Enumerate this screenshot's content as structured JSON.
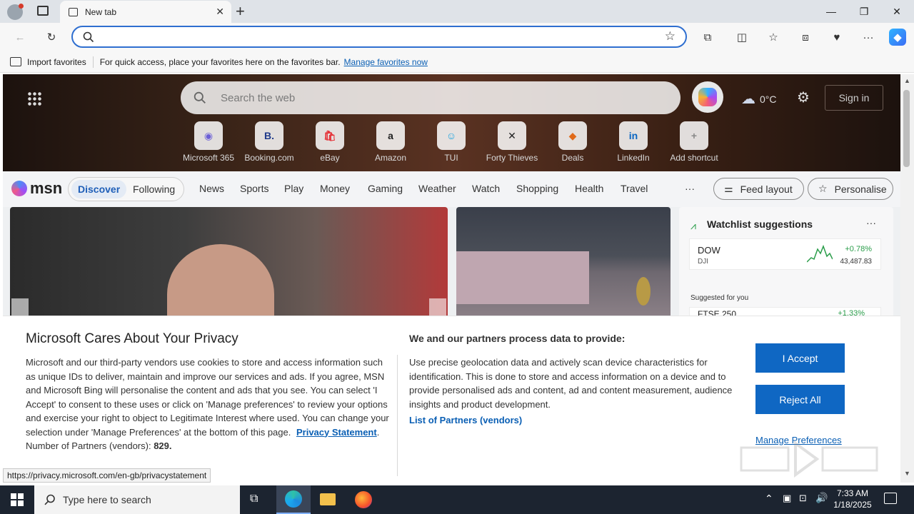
{
  "browser": {
    "tab_title": "New tab",
    "address_value": "",
    "fav_import": "Import favorites",
    "fav_hint": "For quick access, place your favorites here on the favorites bar.",
    "fav_manage": "Manage favorites now"
  },
  "msn": {
    "search_placeholder": "Search the web",
    "temperature": "0°C",
    "sign_in": "Sign in",
    "shortcuts": [
      {
        "label": "Microsoft 365",
        "glyph": "◉"
      },
      {
        "label": "Booking.com",
        "glyph": "B."
      },
      {
        "label": "eBay",
        "glyph": "🛍"
      },
      {
        "label": "Amazon",
        "glyph": "a"
      },
      {
        "label": "TUI",
        "glyph": "☺"
      },
      {
        "label": "Forty Thieves",
        "glyph": "✕"
      },
      {
        "label": "Deals",
        "glyph": "◆"
      },
      {
        "label": "LinkedIn",
        "glyph": "in"
      },
      {
        "label": "Add shortcut",
        "glyph": "+"
      }
    ],
    "logo": "msn",
    "nav": {
      "discover": "Discover",
      "following": "Following",
      "items": [
        "News",
        "Sports",
        "Play",
        "Money",
        "Gaming",
        "Weather",
        "Watch",
        "Shopping",
        "Health",
        "Travel"
      ],
      "more": "···",
      "feed_layout": "Feed layout",
      "personalise": "Personalise"
    },
    "watchlist": {
      "title": "Watchlist suggestions",
      "dow_name": "DOW",
      "dow_sub": "DJI",
      "dow_change": "+0.78%",
      "dow_value": "43,487.83",
      "suggested": "Suggested for you",
      "ftse_name": "FTSE 250",
      "ftse_change": "+1.33%"
    }
  },
  "privacy": {
    "title": "Microsoft Cares About Your Privacy",
    "body": "Microsoft and our third-party vendors use cookies to store and access information such as unique IDs to deliver, maintain and improve our services and ads. If you agree, MSN and Microsoft Bing will personalise the content and ads that you see. You can select 'I Accept' to consent to these uses or click on 'Manage preferences' to review your options and exercise your right to object to Legitimate Interest where used.  You can change your selection under 'Manage Preferences' at the bottom of this page.",
    "privacy_link": "Privacy Statement",
    "partners_label": "Number of Partners (vendors):",
    "partners_count": "829.",
    "right_title": "We and our partners process data to provide:",
    "right_body": "Use precise geolocation data and actively scan device characteristics for identification. This is done to store and access information on a device and to provide personalised ads and content, ad and content measurement, audience insights and product development.",
    "partners_link": "List of Partners (vendors)",
    "accept": "I Accept",
    "reject": "Reject All",
    "manage": "Manage Preferences"
  },
  "status_url": "https://privacy.microsoft.com/en-gb/privacystatement",
  "taskbar": {
    "search_placeholder": "Type here to search",
    "time": "7:33 AM",
    "date": "1/18/2025"
  },
  "colors": {
    "accent": "#0f67c3",
    "link": "#0a5fb4"
  }
}
